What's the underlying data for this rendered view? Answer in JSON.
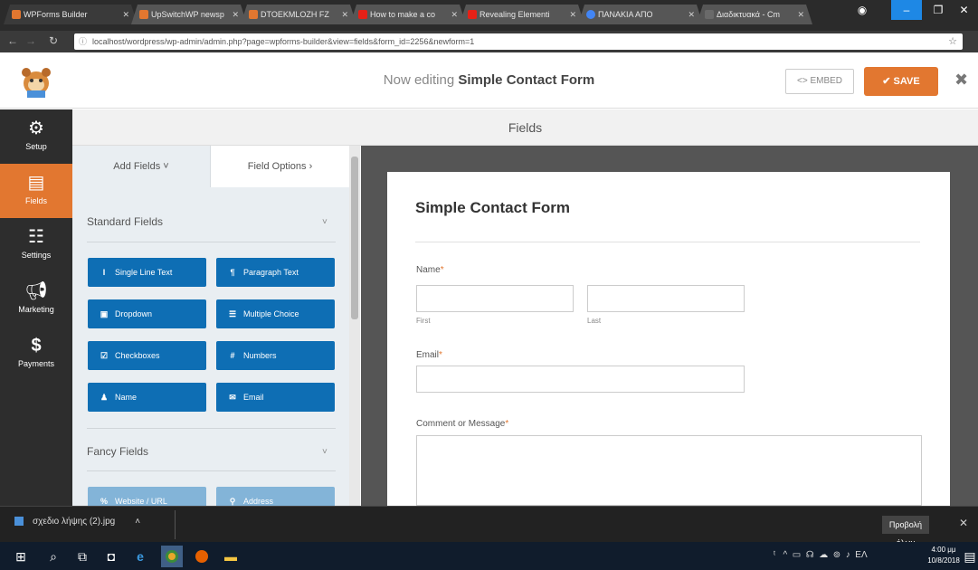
{
  "browser": {
    "tabs": [
      {
        "title": "WPForms Builder",
        "color": "#e27730"
      },
      {
        "title": "UpSwitchWP newsp",
        "color": "#e27730"
      },
      {
        "title": "DTOEKMLOZH FZ",
        "color": "#e27730"
      },
      {
        "title": "How to make a co",
        "color": "#e62117"
      },
      {
        "title": "Revealing Elementi",
        "color": "#e62117"
      },
      {
        "title": "ΠΑΝΑΚΙΑ ΑΠΟ",
        "color": "#4285f4"
      },
      {
        "title": "Διαδικτυακά - Cm",
        "color": "#4a4a4a"
      }
    ],
    "url": "localhost/wordpress/wp-admin/admin.php?page=wpforms-builder&view=fields&form_id=2256&newform=1"
  },
  "header": {
    "editing_prefix": "Now editing",
    "form_name": "Simple Contact Form",
    "embed_label": "<> EMBED",
    "save_label": "✔ SAVE",
    "close_icon": "close-icon"
  },
  "nav": [
    {
      "label": "Setup",
      "icon": "gear-icon"
    },
    {
      "label": "Fields",
      "icon": "fields-icon"
    },
    {
      "label": "Settings",
      "icon": "sliders-icon"
    },
    {
      "label": "Marketing",
      "icon": "megaphone-icon"
    },
    {
      "label": "Payments",
      "icon": "dollar-icon"
    }
  ],
  "fields_title": "Fields",
  "panel": {
    "tab_add": "Add Fields ˅",
    "tab_options": "Field Options ›",
    "standard_heading": "Standard Fields",
    "fancy_heading": "Fancy Fields",
    "standard_fields": [
      {
        "label": "Single Line Text",
        "icon": "I"
      },
      {
        "label": "Paragraph Text",
        "icon": "¶"
      },
      {
        "label": "Dropdown",
        "icon": "▣"
      },
      {
        "label": "Multiple Choice",
        "icon": "☰"
      },
      {
        "label": "Checkboxes",
        "icon": "☑"
      },
      {
        "label": "Numbers",
        "icon": "#"
      },
      {
        "label": "Name",
        "icon": "♟"
      },
      {
        "label": "Email",
        "icon": "✉"
      }
    ],
    "fancy_fields": [
      {
        "label": "Website / URL",
        "icon": "%"
      },
      {
        "label": "Address",
        "icon": "⚲"
      }
    ]
  },
  "form": {
    "title": "Simple Contact Form",
    "name_label": "Name",
    "first_sublabel": "First",
    "last_sublabel": "Last",
    "email_label": "Email",
    "comment_label": "Comment or Message",
    "required_mark": "*"
  },
  "download": {
    "file": "σχεδιο λήψης (2).jpg",
    "show_all": "Προβολή όλων"
  },
  "taskbar": {
    "time": "4:00 μμ",
    "date": "10/8/2018"
  }
}
